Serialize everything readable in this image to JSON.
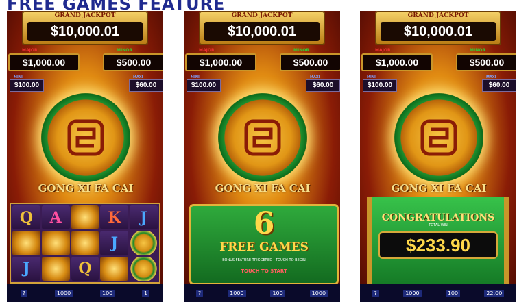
{
  "heading": "FREE GAMES FEATURE",
  "jackpots": {
    "grand_label": "GRAND JACKPOT",
    "grand": "$10,000.01",
    "major_label": "MAJOR",
    "major": "$1,000.00",
    "minor_label": "MINOR",
    "minor": "$500.00",
    "mini_label": "MINI",
    "mini": "$100.00",
    "maxi_label": "MAXI",
    "maxi": "$60.00"
  },
  "game_logo": "GONG XI FA CAI",
  "reels": [
    [
      "Q",
      "A",
      "pot",
      "K",
      "J"
    ],
    [
      "pot",
      "pot",
      "pot",
      "J",
      "bonus"
    ],
    [
      "J",
      "pot",
      "Q",
      "pot",
      "bonus"
    ]
  ],
  "free_games": {
    "count": "6",
    "label": "FREE GAMES",
    "fine_print": "BONUS FEATURE TRIGGERED - TOUCH TO BEGIN",
    "button": "TOUCH TO START"
  },
  "win": {
    "title": "CONGRATULATIONS",
    "subtitle": "TOTAL WIN",
    "amount": "$233.90"
  },
  "status_bar": {
    "a": "?",
    "b": "1000",
    "c": "100",
    "d": "1",
    "e": "1000",
    "f": "22.00"
  },
  "colors": {
    "heading": "#1f2a8f",
    "felt_green": "#2faa3c",
    "gold": "#ffd84a"
  }
}
